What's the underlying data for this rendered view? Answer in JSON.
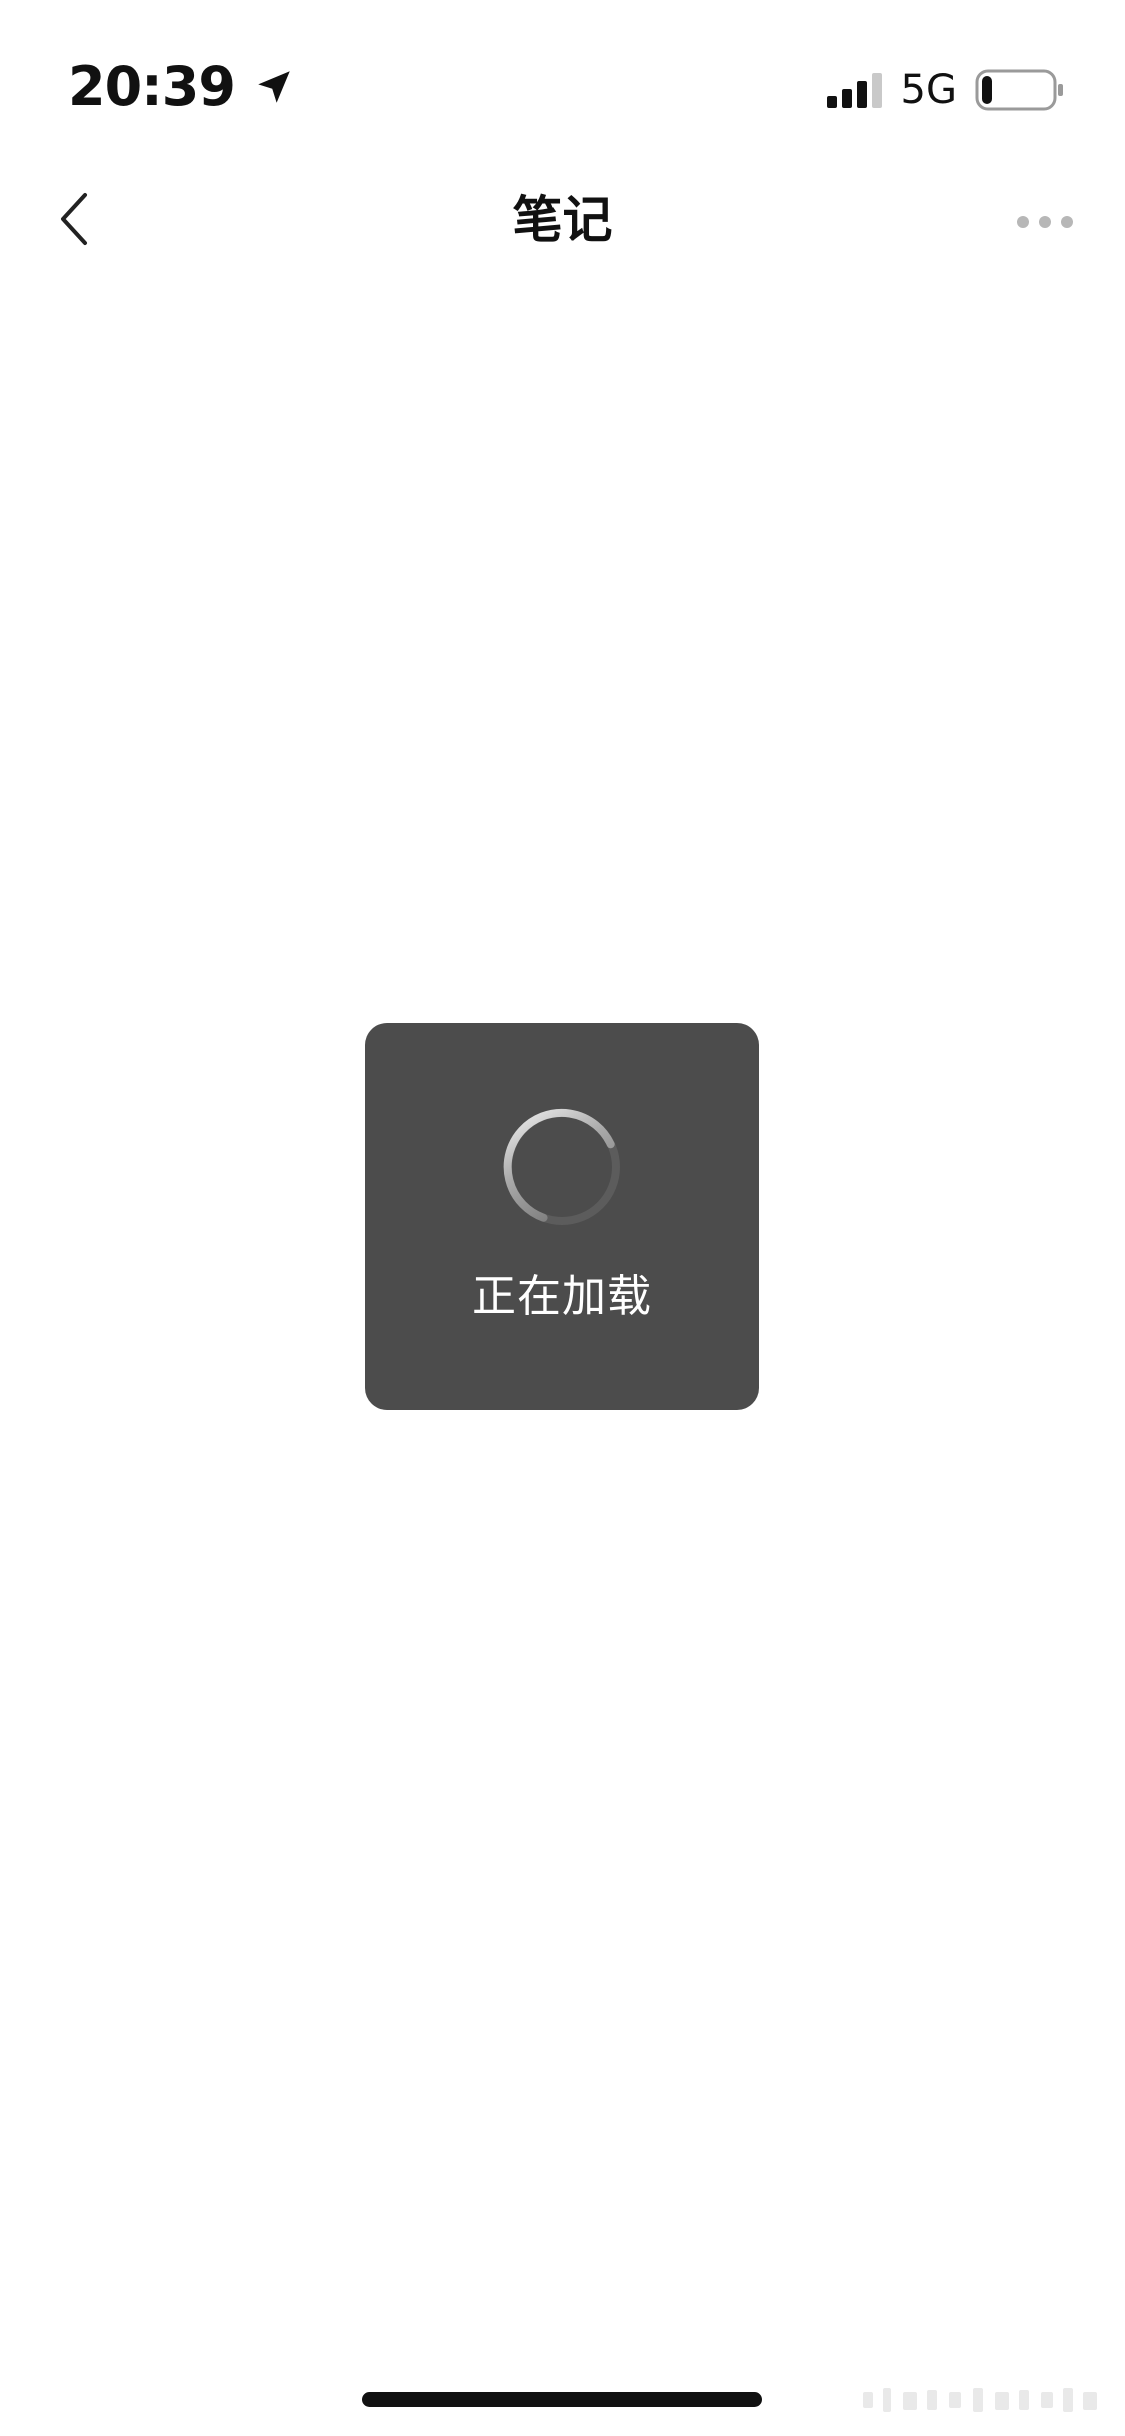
{
  "status_bar": {
    "time": "20:39",
    "location_icon": "location-arrow-icon",
    "signal_icon": "cellular-signal-icon",
    "signal_bars_filled": 3,
    "signal_bars_total": 4,
    "network": "5G",
    "battery_icon": "battery-icon",
    "battery_level": 0.15
  },
  "nav": {
    "back_icon": "chevron-left-icon",
    "title": "笔记",
    "more_icon": "more-dots-icon"
  },
  "loading": {
    "spinner_icon": "loading-spinner-icon",
    "text": "正在加载"
  },
  "colors": {
    "background": "#ffffff",
    "toast_background": "#4c4c4c",
    "toast_text": "#ffffff",
    "text_primary": "#111111",
    "more_dots": "#b7b7b7"
  }
}
